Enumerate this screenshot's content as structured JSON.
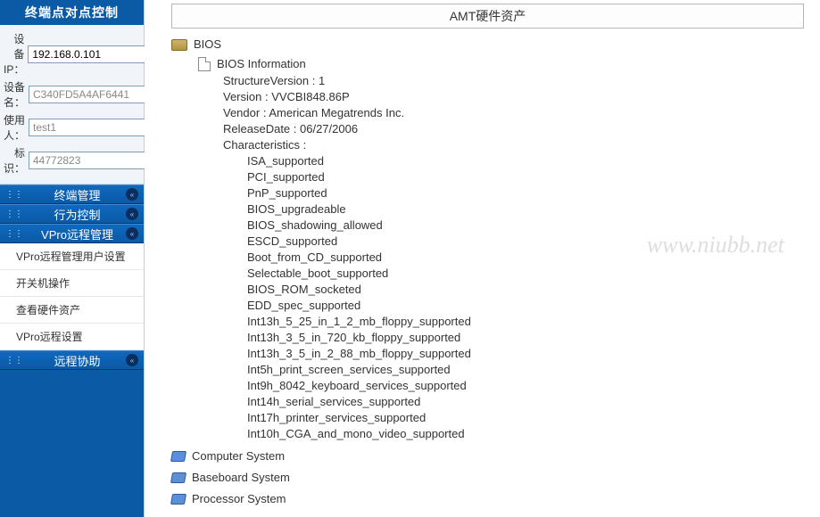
{
  "sidebar": {
    "title": "终端点对点控制",
    "form": {
      "ip_label": "设备IP：",
      "ip_value": "192.168.0.101",
      "name_label": "设备名：",
      "name_value": "C340FD5A4AF6441",
      "user_label": "使用人：",
      "user_value": "test1",
      "tag_label": "标识：",
      "tag_value": "44772823"
    },
    "sections": [
      {
        "label": "终端管理"
      },
      {
        "label": "行为控制"
      },
      {
        "label": "VPro远程管理",
        "items": [
          "VPro远程管理用户设置",
          "开关机操作",
          "查看硬件资产",
          "VPro远程设置"
        ]
      },
      {
        "label": "远程协助"
      }
    ]
  },
  "main": {
    "title": "AMT硬件资产",
    "watermark": "www.niubb.net",
    "bios_label": "BIOS",
    "bios_info_label": "BIOS Information",
    "props": {
      "structure_version": "StructureVersion : 1",
      "version": "Version : VVCBI848.86P",
      "vendor": "Vendor : American Megatrends Inc.",
      "release_date": "ReleaseDate : 06/27/2006",
      "characteristics": "Characteristics :"
    },
    "characteristics": [
      "ISA_supported",
      "PCI_supported",
      "PnP_supported",
      "BIOS_upgradeable",
      "BIOS_shadowing_allowed",
      "ESCD_supported",
      "Boot_from_CD_supported",
      "Selectable_boot_supported",
      "BIOS_ROM_socketed",
      "EDD_spec_supported",
      "Int13h_5_25_in_1_2_mb_floppy_supported",
      "Int13h_3_5_in_720_kb_floppy_supported",
      "Int13h_3_5_in_2_88_mb_floppy_supported",
      "Int5h_print_screen_services_supported",
      "Int9h_8042_keyboard_services_supported",
      "Int14h_serial_services_supported",
      "Int17h_printer_services_supported",
      "Int10h_CGA_and_mono_video_supported"
    ],
    "other_nodes": [
      "Computer System",
      "Baseboard System",
      "Processor System"
    ]
  }
}
